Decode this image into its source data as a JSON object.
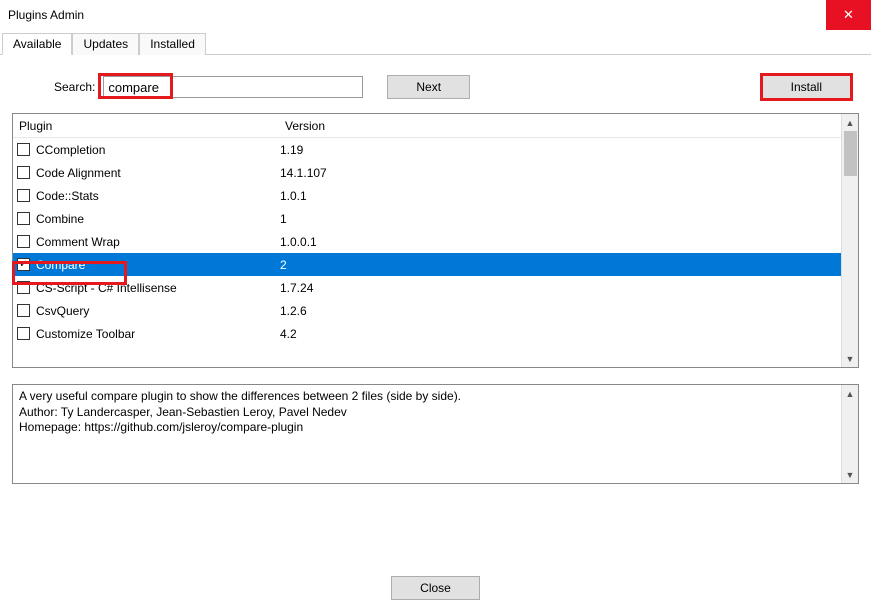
{
  "window": {
    "title": "Plugins Admin",
    "close_icon": "✕"
  },
  "tabs": {
    "available": "Available",
    "updates": "Updates",
    "installed": "Installed"
  },
  "search": {
    "label": "Search:",
    "value": "compare"
  },
  "buttons": {
    "next": "Next",
    "install": "Install",
    "close": "Close"
  },
  "table": {
    "header_plugin": "Plugin",
    "header_version": "Version",
    "rows": [
      {
        "name": "CCompletion",
        "version": "1.19",
        "checked": false
      },
      {
        "name": "Code Alignment",
        "version": "14.1.107",
        "checked": false
      },
      {
        "name": "Code::Stats",
        "version": "1.0.1",
        "checked": false
      },
      {
        "name": "Combine",
        "version": "1",
        "checked": false
      },
      {
        "name": "Comment Wrap",
        "version": "1.0.0.1",
        "checked": false
      },
      {
        "name": "Compare",
        "version": "2",
        "checked": true,
        "selected": true
      },
      {
        "name": "CS-Script - C# Intellisense",
        "version": "1.7.24",
        "checked": false
      },
      {
        "name": "CsvQuery",
        "version": "1.2.6",
        "checked": false
      },
      {
        "name": "Customize Toolbar",
        "version": "4.2",
        "checked": false
      }
    ]
  },
  "description": "A very useful compare plugin to show the differences between 2 files (side by side).\nAuthor: Ty Landercasper, Jean-Sebastien Leroy, Pavel Nedev\nHomepage: https://github.com/jsleroy/compare-plugin"
}
